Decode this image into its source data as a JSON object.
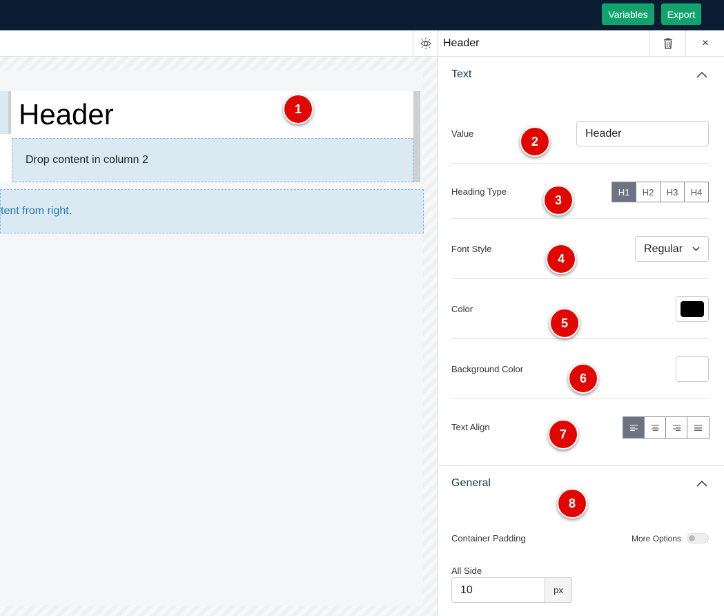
{
  "topbar": {
    "variables_label": "Variables",
    "export_label": "Export"
  },
  "canvas": {
    "header_text": "Header",
    "column2_placeholder": "Drop content in column 2",
    "drop_right_text": "tent from right."
  },
  "panel": {
    "title": "Header",
    "close_label": "×",
    "text_section": {
      "title": "Text",
      "value_label": "Value",
      "value": "Header",
      "heading_type_label": "Heading Type",
      "heading_types": [
        "H1",
        "H2",
        "H3",
        "H4"
      ],
      "heading_selected": "H1",
      "font_style_label": "Font Style",
      "font_style_value": "Regular",
      "color_label": "Color",
      "color_value": "#000000",
      "bg_color_label": "Background Color",
      "bg_color_value": "#ffffff",
      "text_align_label": "Text Align",
      "text_align_options": [
        "align-left-icon",
        "align-center-icon",
        "align-right-icon",
        "align-justify-icon"
      ],
      "text_align_selected": "align-left-icon"
    },
    "general_section": {
      "title": "General",
      "container_padding_label": "Container Padding",
      "more_options_label": "More Options",
      "more_options_enabled": false,
      "all_side_label": "All Side",
      "all_side_value": "10",
      "unit": "px"
    }
  },
  "markers": [
    "1",
    "2",
    "3",
    "4",
    "5",
    "6",
    "7",
    "8"
  ],
  "colors": {
    "topbar": "#0b1d33",
    "button": "#12a36d",
    "marker": "#e10600",
    "drop_zone": "#dbe9f3"
  }
}
